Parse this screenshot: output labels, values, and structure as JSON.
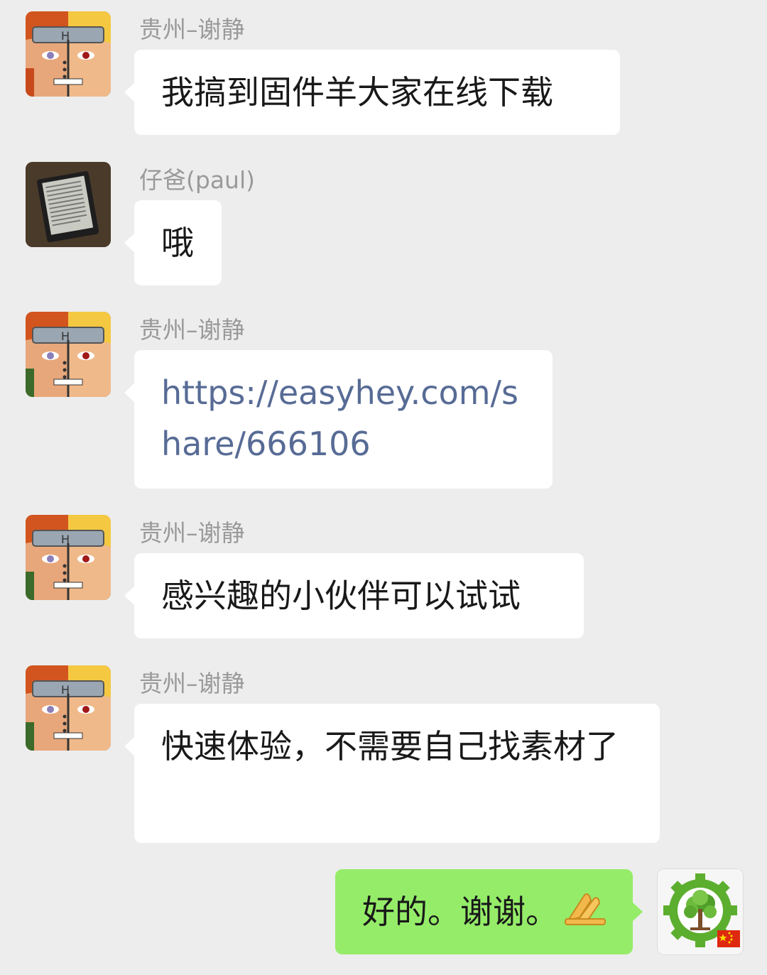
{
  "chat": {
    "messages": [
      {
        "sender": "贵州–谢静",
        "text": "我搞到固件羊大家在线下载",
        "avatar": "naruto-avatar-icon"
      },
      {
        "sender": "仔爸(paul)",
        "text": "哦",
        "avatar": "ereader-avatar-icon"
      },
      {
        "sender": "贵州–谢静",
        "text": "https://easyhey.com/share/666106",
        "avatar": "naruto-avatar-icon",
        "is_link": true
      },
      {
        "sender": "贵州–谢静",
        "text": "感兴趣的小伙伴可以试试",
        "avatar": "naruto-avatar-icon"
      },
      {
        "sender": "贵州–谢静",
        "text": "快速体验，不需要自己找素材了",
        "avatar": "naruto-avatar-icon"
      }
    ],
    "self_message": {
      "text": "好的。谢谢。",
      "emoji": "folded-hands-icon",
      "avatar": "tree-gear-avatar-icon"
    }
  },
  "colors": {
    "background": "#ededed",
    "bubble_incoming": "#ffffff",
    "bubble_outgoing": "#95ec69",
    "link": "#576b95",
    "sender_name": "#9a9a9a"
  }
}
